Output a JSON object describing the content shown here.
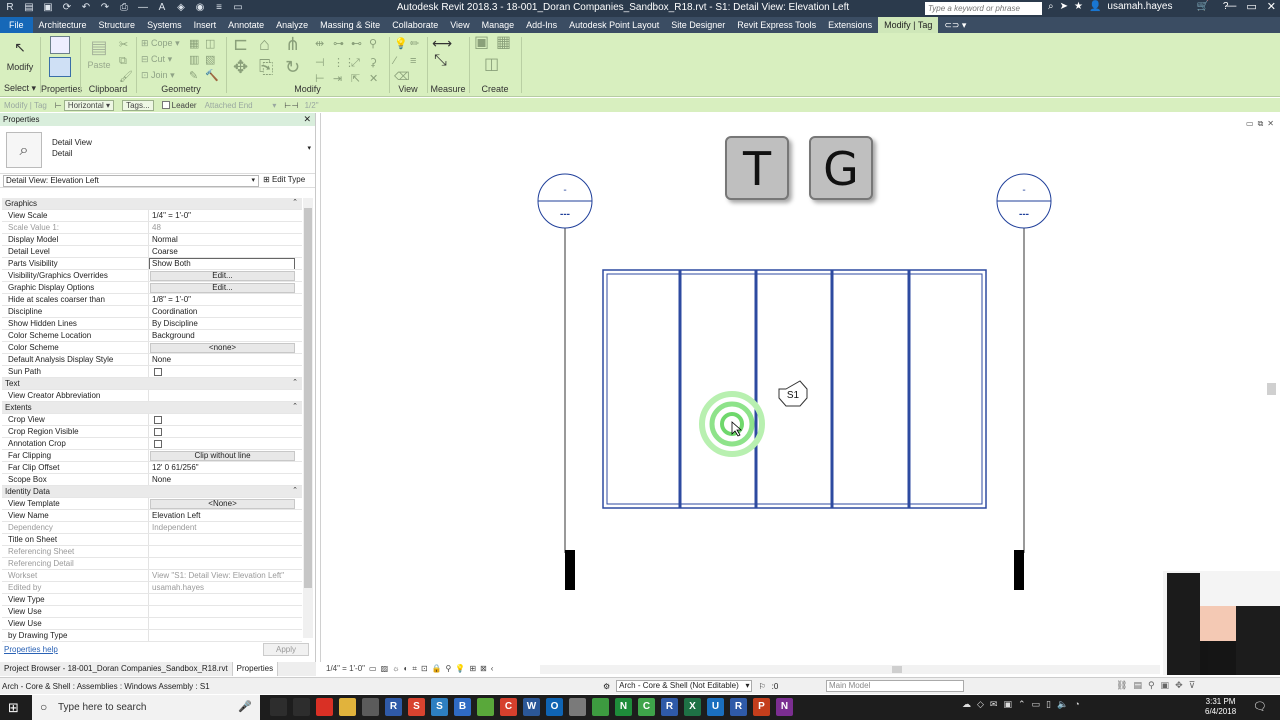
{
  "titlebar": {
    "title": "Autodesk Revit 2018.3 -    18-001_Doran Companies_Sandbox_R18.rvt - S1: Detail View: Elevation Left",
    "search_placeholder": "Type a keyword or phrase",
    "username": "usamah.hayes"
  },
  "ribbon_tabs": [
    "File",
    "Architecture",
    "Structure",
    "Systems",
    "Insert",
    "Annotate",
    "Analyze",
    "Massing & Site",
    "Collaborate",
    "View",
    "Manage",
    "Add-Ins",
    "Autodesk Point Layout",
    "Site Designer",
    "Revit Express Tools",
    "Extensions",
    "Modify | Tag"
  ],
  "ribbon": {
    "modify_label": "Modify",
    "select_label": "Select",
    "properties_label": "Properties",
    "paste_label": "Paste",
    "clipboard_label": "Clipboard",
    "cope_label": "Cope",
    "cut_label": "Cut",
    "join_label": "Join",
    "geometry_label": "Geometry",
    "modify_group_label": "Modify",
    "view_label": "View",
    "measure_label": "Measure",
    "create_label": "Create"
  },
  "optionsbar": {
    "context": "Modify | Tag",
    "orientation": "Horizontal",
    "tags_button": "Tags...",
    "leader_label": "Leader",
    "attached": "Attached End",
    "length": "1/2\""
  },
  "properties": {
    "header": "Properties",
    "type_line1": "Detail View",
    "type_line2": "Detail",
    "instance": "Detail View: Elevation Left",
    "edit_type": "Edit Type",
    "help": "Properties help",
    "apply": "Apply",
    "rows": [
      {
        "kind": "sec",
        "name": "Graphics"
      },
      {
        "name": "View Scale",
        "value": "1/4\" = 1'-0\""
      },
      {
        "name": "Scale Value    1:",
        "value": "48",
        "dis": true
      },
      {
        "name": "Display Model",
        "value": "Normal"
      },
      {
        "name": "Detail Level",
        "value": "Coarse"
      },
      {
        "name": "Parts Visibility",
        "value": "Show Both",
        "box": true
      },
      {
        "name": "Visibility/Graphics Overrides",
        "value": "Edit...",
        "btn": true
      },
      {
        "name": "Graphic Display Options",
        "value": "Edit...",
        "btn": true
      },
      {
        "name": "Hide at scales coarser than",
        "value": "1/8\" = 1'-0\""
      },
      {
        "name": "Discipline",
        "value": "Coordination"
      },
      {
        "name": "Show Hidden Lines",
        "value": "By Discipline"
      },
      {
        "name": "Color Scheme Location",
        "value": "Background"
      },
      {
        "name": "Color Scheme",
        "value": "<none>",
        "btn": true
      },
      {
        "name": "Default Analysis Display Style",
        "value": "None"
      },
      {
        "name": "Sun Path",
        "value": "",
        "cb": true
      },
      {
        "kind": "sec",
        "name": "Text"
      },
      {
        "name": "View Creator Abbreviation",
        "value": ""
      },
      {
        "kind": "sec",
        "name": "Extents"
      },
      {
        "name": "Crop View",
        "value": "",
        "cb": true
      },
      {
        "name": "Crop Region Visible",
        "value": "",
        "cb": true
      },
      {
        "name": "Annotation Crop",
        "value": "",
        "cb": true
      },
      {
        "name": "Far Clipping",
        "value": "Clip without line",
        "btn": true
      },
      {
        "name": "Far Clip Offset",
        "value": "12'  0 61/256\""
      },
      {
        "name": "Scope Box",
        "value": "None"
      },
      {
        "kind": "sec",
        "name": "Identity Data"
      },
      {
        "name": "View Template",
        "value": "<None>",
        "btn": true
      },
      {
        "name": "View Name",
        "value": "Elevation Left"
      },
      {
        "name": "Dependency",
        "value": "Independent",
        "dis": true
      },
      {
        "name": "Title on Sheet",
        "value": ""
      },
      {
        "name": "Referencing Sheet",
        "value": "",
        "dis": true
      },
      {
        "name": "Referencing Detail",
        "value": "",
        "dis": true
      },
      {
        "name": "Workset",
        "value": "View \"S1: Detail View: Elevation Left\"",
        "dis": true
      },
      {
        "name": "Edited by",
        "value": "usamah.hayes",
        "dis": true
      },
      {
        "name": "View Type",
        "value": ""
      },
      {
        "name": "View Use",
        "value": ""
      },
      {
        "name": "View Use",
        "value": ""
      },
      {
        "name": "by Drawing Type",
        "value": ""
      }
    ]
  },
  "bottom_tabs": [
    "Project Browser - 18-001_Doran Companies_Sandbox_R18.rvt",
    "Properties"
  ],
  "canvas": {
    "key_t": "T",
    "key_g": "G",
    "level_top": "-",
    "level_bottom": "---",
    "tag_label": "S1",
    "scale": "1/4\" = 1'-0\""
  },
  "statusbar": {
    "text": "Arch - Core & Shell : Assemblies : Windows Assembly : S1",
    "workset": "Arch - Core & Shell (Not Editable)",
    "filter_count": ":0",
    "model": "Main Model"
  },
  "taskbar": {
    "search": "Type here to search",
    "time": "3:31 PM",
    "date": "6/4/2018",
    "icons": [
      {
        "letter": "",
        "color": "#2d2d2d"
      },
      {
        "letter": "",
        "color": "#2d2d2d"
      },
      {
        "letter": "",
        "color": "#d93025"
      },
      {
        "letter": "",
        "color": "#e1b33c"
      },
      {
        "letter": "",
        "color": "#5b5b5b"
      },
      {
        "letter": "R",
        "color": "#2f5aa8"
      },
      {
        "letter": "S",
        "color": "#d8432f"
      },
      {
        "letter": "S",
        "color": "#2d7fc1"
      },
      {
        "letter": "B",
        "color": "#2f6bc4"
      },
      {
        "letter": "",
        "color": "#59a83a"
      },
      {
        "letter": "C",
        "color": "#d6402d"
      },
      {
        "letter": "W",
        "color": "#2b5797"
      },
      {
        "letter": "O",
        "color": "#0f64b3"
      },
      {
        "letter": "",
        "color": "#7a7a7a"
      },
      {
        "letter": "",
        "color": "#3d9b40"
      },
      {
        "letter": "N",
        "color": "#1e8c3a"
      },
      {
        "letter": "C",
        "color": "#3ea44a"
      },
      {
        "letter": "R",
        "color": "#2f5aa8"
      },
      {
        "letter": "X",
        "color": "#1e7145"
      },
      {
        "letter": "U",
        "color": "#1a6fbf"
      },
      {
        "letter": "R",
        "color": "#2f5aa8"
      },
      {
        "letter": "P",
        "color": "#c43e1c"
      },
      {
        "letter": "N",
        "color": "#7b2e91"
      }
    ]
  },
  "colors": {
    "ribbon": "#d8efbf",
    "titlebar": "#2b3a4c",
    "window_lines": "#2d4aa0",
    "highlight": "#7ee27e"
  }
}
